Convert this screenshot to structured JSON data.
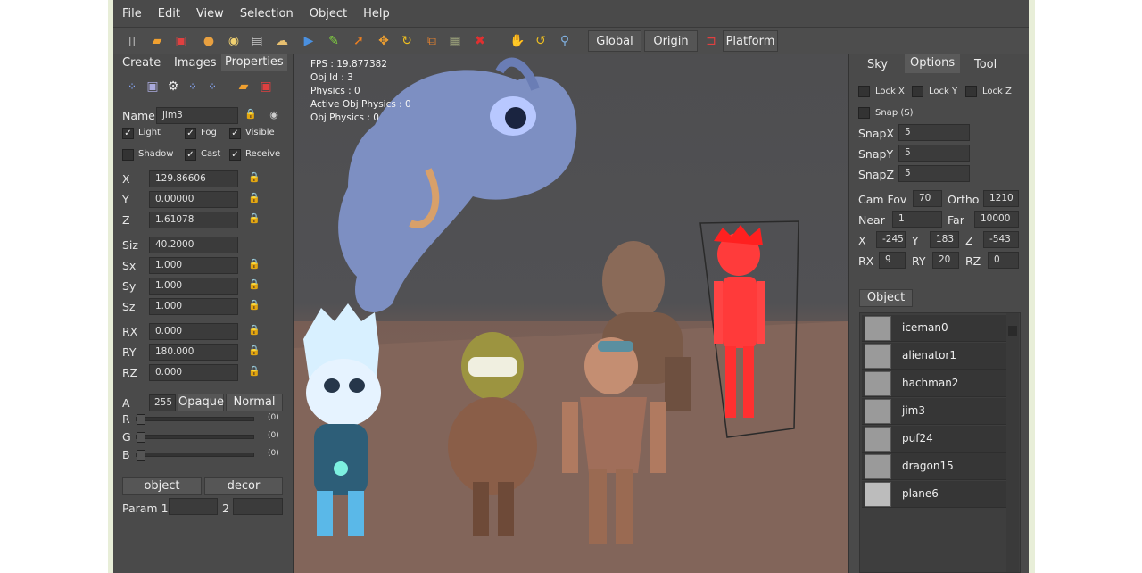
{
  "menu": [
    "File",
    "Edit",
    "View",
    "Selection",
    "Object",
    "Help"
  ],
  "toolbar": {
    "icons": [
      "new-file-icon",
      "open-folder-icon",
      "save-icon",
      "monkey-icon",
      "light-bulb-icon",
      "camera-icon",
      "cloud-icon",
      "play-icon",
      "pencil-icon",
      "select-arrow-icon",
      "move-icon",
      "rotate-icon",
      "scale-icon",
      "image-icon",
      "delete-icon",
      "hand-icon",
      "undo-icon",
      "zoom-icon"
    ],
    "global_label": "Global",
    "origin_label": "Origin",
    "platform_label": "Platform"
  },
  "left": {
    "tabs": [
      "Create",
      "Images",
      "Properties"
    ],
    "active_tab": "Properties",
    "name_label": "Name",
    "name_value": "jim3",
    "checks": [
      {
        "label": "Light",
        "checked": true
      },
      {
        "label": "Fog",
        "checked": true
      },
      {
        "label": "Visible",
        "checked": true
      },
      {
        "label": "Shadow",
        "checked": false
      },
      {
        "label": "Cast",
        "checked": true
      },
      {
        "label": "Receive",
        "checked": true
      }
    ],
    "fields": [
      {
        "label": "X",
        "value": "129.86606"
      },
      {
        "label": "Y",
        "value": "0.00000"
      },
      {
        "label": "Z",
        "value": "1.61078"
      },
      {
        "label": "Siz",
        "value": "40.2000"
      },
      {
        "label": "Sx",
        "value": "1.000"
      },
      {
        "label": "Sy",
        "value": "1.000"
      },
      {
        "label": "Sz",
        "value": "1.000"
      },
      {
        "label": "RX",
        "value": "0.000"
      },
      {
        "label": "RY",
        "value": "180.000"
      },
      {
        "label": "RZ",
        "value": "0.000"
      }
    ],
    "alpha_label": "A",
    "alpha_value": "255",
    "opaque_label": "Opaque",
    "normal_label": "Normal",
    "rgb": [
      {
        "label": "R",
        "value": "(0)"
      },
      {
        "label": "G",
        "value": "(0)"
      },
      {
        "label": "B",
        "value": "(0)"
      }
    ],
    "object_btn": "object",
    "decor_btn": "decor",
    "param_label": "Param 1",
    "param2_label": "2"
  },
  "viewport": {
    "stats": [
      "FPS : 19.877382",
      "Obj Id : 3",
      "Physics : 0",
      "Active Obj Physics : 0",
      "Obj Physics : 0"
    ]
  },
  "right": {
    "tabs": [
      "Sky",
      "Options",
      "Tool"
    ],
    "active_tab": "Options",
    "locks": [
      "Lock X",
      "Lock Y",
      "Lock Z"
    ],
    "snap_label": "Snap (S)",
    "snapx_label": "SnapX",
    "snapx": "5",
    "snapy_label": "SnapY",
    "snapy": "5",
    "snapz_label": "SnapZ",
    "snapz": "5",
    "camfov_label": "Cam Fov",
    "camfov": "70",
    "ortho_label": "Ortho",
    "ortho": "1210",
    "near_label": "Near",
    "near": "1",
    "far_label": "Far",
    "far": "10000",
    "x_label": "X",
    "x": "-245",
    "y_label": "Y",
    "y": "183",
    "z_label": "Z",
    "z": "-543",
    "rx_label": "RX",
    "rx": "9",
    "ry_label": "RY",
    "ry": "20",
    "rz_label": "RZ",
    "rz": "0",
    "object_tab": "Object",
    "objects": [
      "iceman0",
      "alienator1",
      "hachman2",
      "jim3",
      "puf24",
      "dragon15",
      "plane6"
    ]
  }
}
